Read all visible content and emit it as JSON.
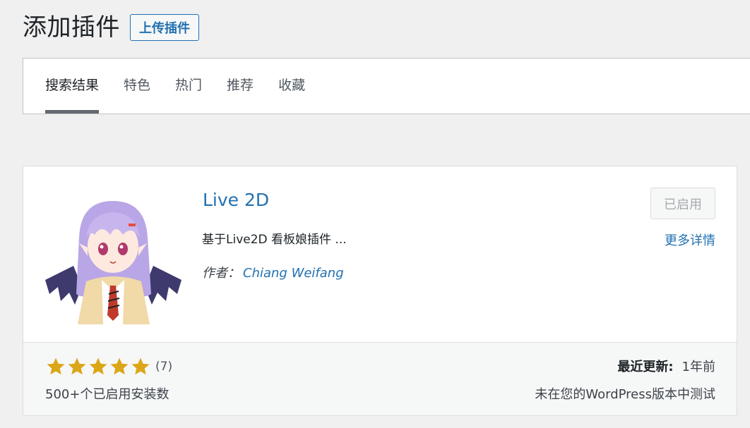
{
  "header": {
    "title": "添加插件",
    "upload_label": "上传插件"
  },
  "tabs": [
    {
      "label": "搜索结果",
      "current": true
    },
    {
      "label": "特色"
    },
    {
      "label": "热门"
    },
    {
      "label": "推荐"
    },
    {
      "label": "收藏"
    }
  ],
  "plugin": {
    "name": "Live 2D",
    "description": "基于Live2D 看板娘插件 ...",
    "author_prefix": "作者：",
    "author_name": "Chiang Weifang",
    "status_button": "已启用",
    "details_link": "更多详情",
    "rating": {
      "stars": 5,
      "count_label": "(7)"
    },
    "installs": "500+个已启用安装数",
    "last_updated_label": "最近更新:",
    "last_updated_value": "1年前",
    "compatibility": "未在您的WordPress版本中测试"
  },
  "colors": {
    "accent": "#2271b1",
    "star": "#dba617",
    "background": "#f0f0f1"
  }
}
